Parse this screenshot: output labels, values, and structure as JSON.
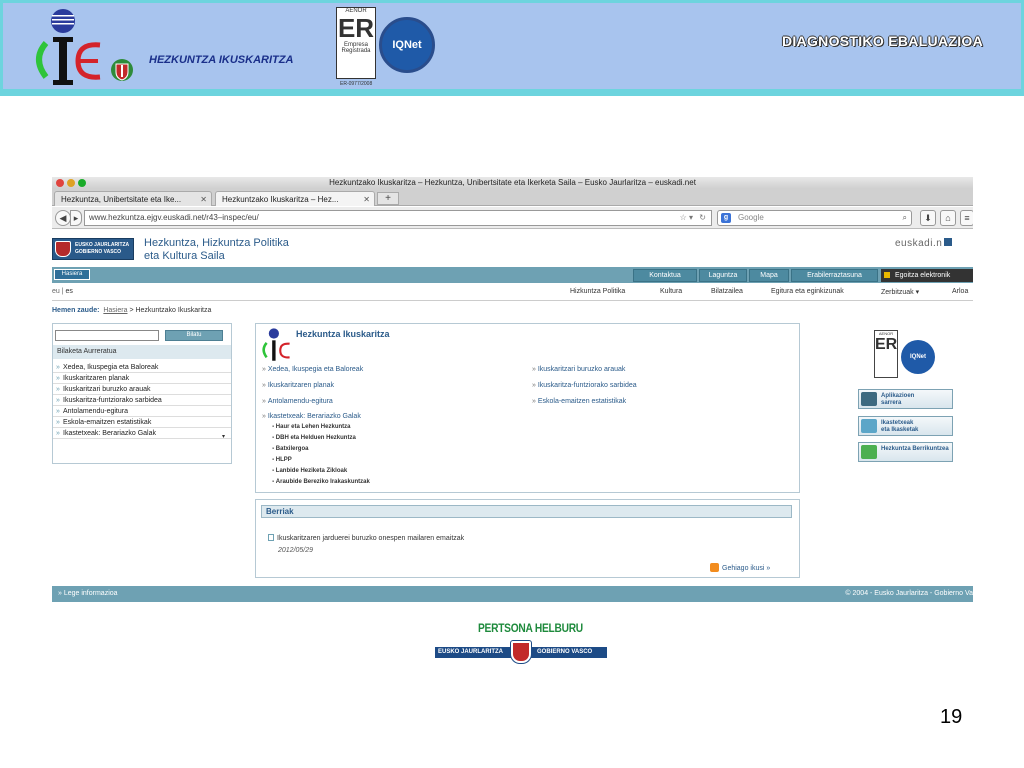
{
  "slide": {
    "org_name": "HEZKUNTZA IKUSKARITZA",
    "title": "DIAGNOSTIKO EBALUAZIOA",
    "aenor_label": "AENOR",
    "aenor_er": "ER",
    "aenor_sub": "Empresa Registrada",
    "iqnet_label": "IQNet",
    "cert_code": "ER-0977/2008",
    "page_number": "19",
    "bottom_slogan": "PERTSONA HELBURU",
    "bottom_gov_left": "EUSKO JAURLARITZA",
    "bottom_gov_right": "GOBIERNO VASCO"
  },
  "browser": {
    "window_title": "Hezkuntzako Ikuskaritza – Hezkuntza, Unibertsitate eta Ikerketa Saila – Eusko Jaurlaritza – euskadi.net",
    "tabs": [
      {
        "label": "Hezkuntza, Unibertsitate eta Ike..."
      },
      {
        "label": "Hezkuntzako Ikuskaritza – Hez..."
      }
    ],
    "new_tab": "+",
    "url": "www.hezkuntza.ejgv.euskadi.net/r43–inspec/eu/",
    "search_placeholder": "Google"
  },
  "site": {
    "gov_logo_text": "EUSKO JAURLARITZA\nGOBIERNO VASCO",
    "dept_title_1": "Hezkuntza, Hizkuntza Politika",
    "dept_title_2": "eta Kultura Saila",
    "euskadi_logo": "euskadi.n",
    "home_button": "Hasiera",
    "top_buttons": [
      "Kontaktua",
      "Laguntza",
      "Mapa",
      "Erabilerraztasuna"
    ],
    "egoitza": "Egoitza elektronik",
    "lang_eu": "eu",
    "lang_sep": " | ",
    "lang_es": "es",
    "main_menu": [
      "Hizkuntza Politika",
      "Kultura",
      "Bilatzailea",
      "Egitura eta eginkizunak",
      "Zerbitzuak ▾",
      "Arloa"
    ],
    "breadcrumb_label": "Hemen zaude:",
    "breadcrumb_home": "Hasiera",
    "breadcrumb_sep": " > ",
    "breadcrumb_current": "Hezkuntzako Ikuskaritza",
    "search_button": "Bilatu",
    "quick_search": "Bilaketa Aurreratua",
    "left_items": [
      "Xedea, Ikuspegia eta Baloreak",
      "Ikuskaritzaren planak",
      "Ikuskaritzari buruzko arauak",
      "Ikuskaritza-funtziorako sarbidea",
      "Antolamendu-egitura",
      "Eskola-emaitzen estatistikak",
      "Ikastetxeak: Berariazko Galak"
    ],
    "left_scroll": "▾",
    "center_title": "Hezkuntza Ikuskaritza",
    "center_links_left": [
      "Xedea, Ikuspegia eta Baloreak",
      "Ikuskaritzaren planak",
      "Antolamendu-egitura",
      "Ikastetxeak: Berariazko Galak"
    ],
    "center_links_right": [
      "Ikuskaritzari buruzko arauak",
      "Ikuskaritza-funtziorako sarbidea",
      "Eskola-emaitzen estatistikak"
    ],
    "sub_links": [
      "Haur eta Lehen Hezkuntza",
      "DBH eta Helduen Hezkuntza",
      "Batxilergoa",
      "HLPP",
      "Lanbide Heziketa Zikloak",
      "Araubide Bereziko Irakaskuntzak"
    ],
    "news_title": "Berriak",
    "news_item": "Ikuskaritzaren jarduerei buruzko onespen mailaren emaitzak",
    "news_date": "2012/05/29",
    "news_more": "Gehiago ikusi »",
    "right_aenor": "AENOR",
    "right_er": "ER",
    "right_iqnet": "IQNet",
    "right_buttons": [
      "Aplikazioen\nsarrera",
      "Ikastetxeak\neta Ikasketak",
      "Hezkuntza Berrikuntzea"
    ],
    "footer_left": "»  Lege informazioa",
    "footer_right": "© 2004 - Eusko Jaurlaritza - Gobierno Va"
  },
  "colors": {
    "header_bg": "#a8c4ee",
    "header_border": "#6dd4de",
    "site_accent": "#6ea1b3",
    "link_blue": "#2b5b8a",
    "slogan_green": "#1e8a3c"
  }
}
